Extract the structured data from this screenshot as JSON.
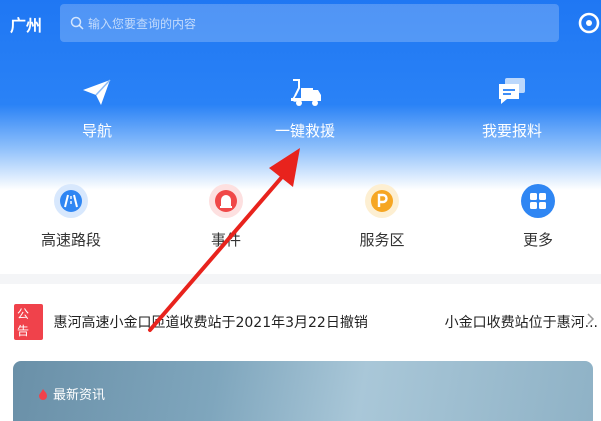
{
  "header": {
    "city": "广州",
    "search_placeholder": "输入您要查询的内容",
    "quick_actions": [
      {
        "label": "导航",
        "icon": "paper-plane-icon"
      },
      {
        "label": "一键救援",
        "icon": "tow-truck-icon"
      },
      {
        "label": "我要报料",
        "icon": "chat-report-icon"
      }
    ]
  },
  "services": [
    {
      "label": "高速路段",
      "icon": "highway-icon",
      "color": "#2f86f3"
    },
    {
      "label": "事件",
      "icon": "alarm-light-icon",
      "color": "#f04848"
    },
    {
      "label": "服务区",
      "icon": "parking-icon",
      "color": "#f6a623"
    },
    {
      "label": "更多",
      "icon": "grid-icon",
      "color": "#2f86f3"
    }
  ],
  "notice": {
    "tag": "公告",
    "text1": "惠河高速小金口匝道收费站于2021年3月22日撤销",
    "text2": "小金口收费站位于惠河..."
  },
  "news": {
    "title": "最新资讯"
  },
  "colors": {
    "header_blue": "#1f77f3",
    "notice_red": "#f0424b",
    "annotation_arrow": "#e8231d"
  }
}
